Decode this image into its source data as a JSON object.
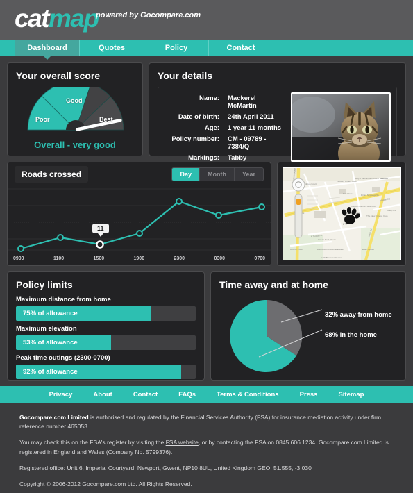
{
  "brand": {
    "name_part1": "cat",
    "name_part2": "map",
    "tagline": "powered by Gocompare.com",
    "accent_color": "#2dbfb1"
  },
  "nav": {
    "tabs": [
      {
        "label": "Dashboard",
        "active": true
      },
      {
        "label": "Quotes",
        "active": false
      },
      {
        "label": "Policy",
        "active": false
      },
      {
        "label": "Contact",
        "active": false
      }
    ]
  },
  "score": {
    "title": "Your overall score",
    "segments": [
      "Poor",
      "Good",
      "Best"
    ],
    "caption": "Overall - very good"
  },
  "details": {
    "title": "Your details",
    "rows": [
      {
        "key": "Name:",
        "value": "Mackerel McMartin"
      },
      {
        "key": "Date of birth:",
        "value": "24th April 2011"
      },
      {
        "key": "Age:",
        "value": "1 year 11 months"
      },
      {
        "key": "Policy number:",
        "value": "CM - 09789 - 7384/Q"
      },
      {
        "key": "Markings:",
        "value": "Tabby"
      }
    ],
    "photo_alt": "cat-photo"
  },
  "chart_data": {
    "type": "line",
    "title": "Roads crossed",
    "xlabel": "",
    "ylabel": "",
    "x": [
      "0900",
      "1100",
      "1500",
      "1900",
      "2300",
      "0300",
      "0700"
    ],
    "categories": [
      "0900",
      "1100",
      "1500",
      "1900",
      "2300",
      "0300",
      "0700"
    ],
    "values": [
      4,
      13,
      11,
      16,
      28,
      22,
      26
    ],
    "ylim": [
      0,
      32
    ],
    "grid": true,
    "legend": "none",
    "annotation": {
      "label": "11",
      "at_category": "1500",
      "value": 11
    },
    "range_options": [
      {
        "label": "Day",
        "active": true
      },
      {
        "label": "Month",
        "active": false
      },
      {
        "label": "Year",
        "active": false
      }
    ]
  },
  "map": {
    "name": "location-map",
    "marker": "paw-print"
  },
  "limits": {
    "title": "Policy limits",
    "items": [
      {
        "label": "Maximum distance from home",
        "value": "75% of allowance",
        "percent": 75
      },
      {
        "label": "Maximum elevation",
        "value": "53% of allowance",
        "percent": 53
      },
      {
        "label": "Peak time outings (2300-0700)",
        "value": "92% of allowance",
        "percent": 92
      }
    ]
  },
  "time_chart": {
    "type": "pie",
    "title": "Time away and at home",
    "labels": [
      "32% away from home",
      "68% in the home"
    ],
    "slices": [
      {
        "name": "away from home",
        "value": 32,
        "color": "#6d6d70"
      },
      {
        "name": "in the home",
        "value": 68,
        "color": "#2dbfb1"
      }
    ]
  },
  "footer": {
    "links": [
      "Privacy",
      "About",
      "Contact",
      "FAQs",
      "Terms & Conditions",
      "Press",
      "Sitemap"
    ],
    "legal_1_bold": "Gocompare.com Limited",
    "legal_1_rest": " is authorised and regulated by the Financial Services Authority (FSA) for insurance mediation activity under firm reference number 465053.",
    "legal_2_a": "You may check this on the FSA's register by visiting the ",
    "legal_2_link": "FSA website",
    "legal_2_b": ", or by contacting the FSA on 0845 606 1234. Gocompare.com Limited is registered in England and Wales (Company No. 5799376).",
    "legal_3": "Registered office: Unit 6, Imperial Courtyard, Newport, Gwent, NP10 8UL, United Kingdom GEO: 51.555, -3.030",
    "legal_4": "Copyright © 2006-2012 Gocompare.com Ltd. All Rights Reserved."
  }
}
